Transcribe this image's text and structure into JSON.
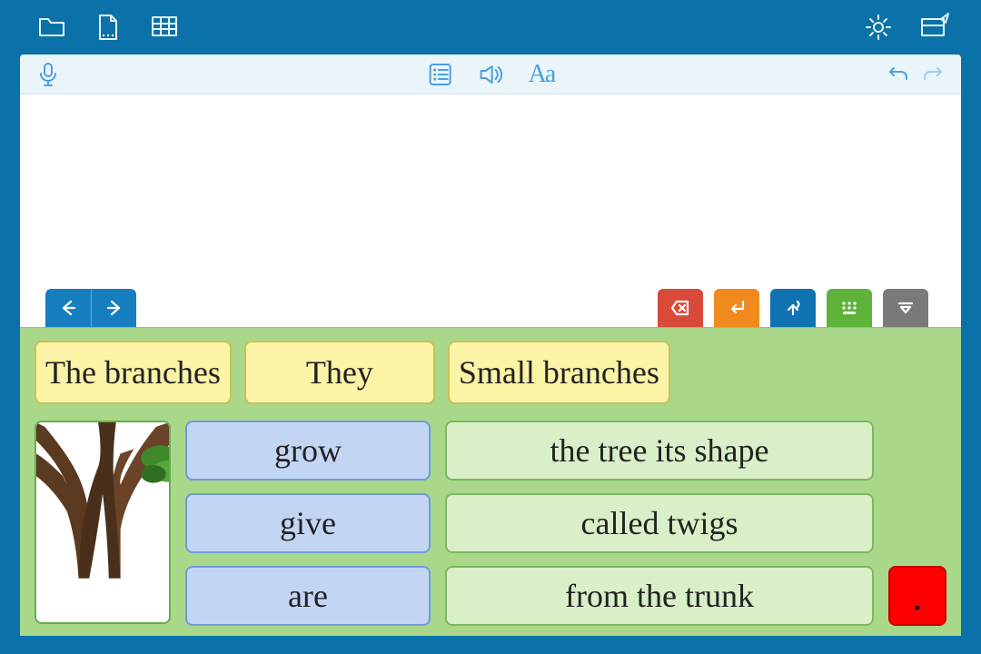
{
  "toolbar": {
    "open": "Open",
    "new": "New",
    "grid": "Grid",
    "settings": "Settings",
    "edit": "Edit"
  },
  "ribbon": {
    "mic": "Microphone",
    "list": "Word List",
    "speak": "Speak",
    "font": "Aa",
    "undo": "Undo",
    "redo": "Redo"
  },
  "nav": {
    "prev": "Previous",
    "next": "Next"
  },
  "actions": {
    "delete": "Delete",
    "enter": "Enter",
    "say": "Speak",
    "keyboard": "Keyboard",
    "collapse": "Collapse"
  },
  "board": {
    "subjects": [
      "The branches",
      "They",
      "Small branches"
    ],
    "verbs": [
      "grow",
      "give",
      "are"
    ],
    "objects": [
      "the tree its shape",
      "called twigs",
      "from the trunk"
    ],
    "punct": ".",
    "image_alt": "tree trunk with branches and leaves"
  }
}
